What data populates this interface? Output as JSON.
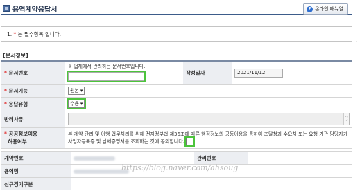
{
  "header": {
    "title": "용역계약응답서",
    "manual_button": "온라인 매뉴얼"
  },
  "notice": {
    "prefix": "1. ",
    "required_mark": "*",
    "text": " 는 필수항목 입니다."
  },
  "right_mark": ".",
  "section_title": "[문서정보]",
  "form": {
    "doc_number": {
      "label": "문서번호",
      "hint": "※ 업체에서 관리하는 문서번호입니다.",
      "value": ""
    },
    "created_date": {
      "label": "작성일자",
      "value": "2021/11/12"
    },
    "doc_function": {
      "label": "문서기능",
      "value": "원본"
    },
    "response_type": {
      "label": "응답유형",
      "value": "수용"
    },
    "rejection_reason": {
      "label": "반려사유",
      "value": ""
    },
    "consent": {
      "label_line1": "공공정보이용",
      "label_line2": "허용여부",
      "text": "본 계약 관리 및 이행 업무처리를 위해 전자정부법 제36조에 따른 행정정보의 공동이용을 통하여 조달청과 수요처 또는 요청 기관 담당자가 사업자등록증 및 납세증명서를 조회하는 것에 동의합니다."
    }
  },
  "lower": {
    "contract_number": "계약번호",
    "manager_number": "관리번호",
    "service_name": "용역명",
    "new_procurement": "신규경기구분"
  },
  "watermark": "https://blog.naver.com/ahsoug"
}
